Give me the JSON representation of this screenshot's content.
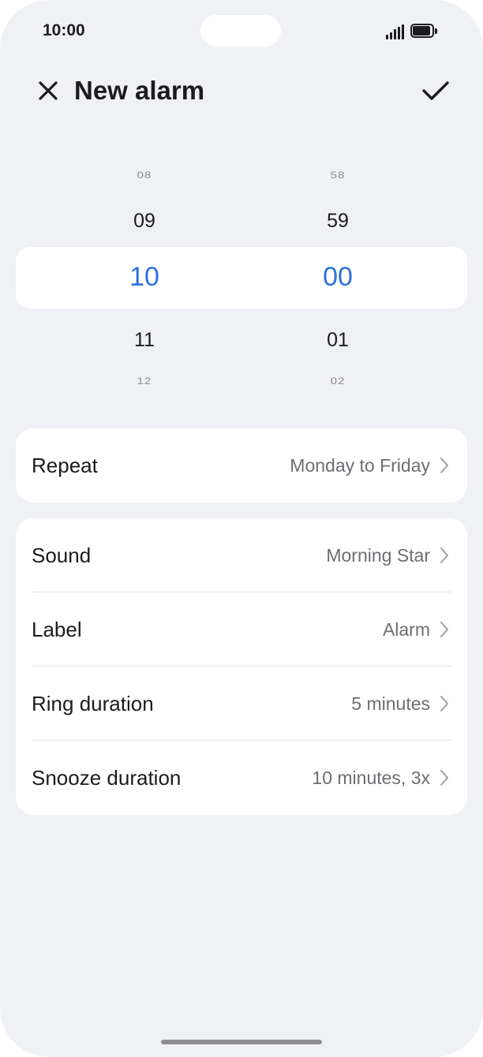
{
  "status_bar": {
    "time": "10:00",
    "icons": [
      "signal-icon",
      "battery-icon"
    ]
  },
  "header": {
    "title": "New alarm",
    "close_icon": "close-icon",
    "confirm_icon": "checkmark-icon"
  },
  "picker": {
    "hours": {
      "above2": "08",
      "above1": "09",
      "selected": "10",
      "below1": "11",
      "below2": "12"
    },
    "minutes": {
      "above2": "58",
      "above1": "59",
      "selected": "00",
      "below1": "01",
      "below2": "02"
    },
    "accent_color": "#2f6fe0"
  },
  "repeat": {
    "label": "Repeat",
    "value": "Monday to Friday"
  },
  "settings": [
    {
      "label": "Sound",
      "value": "Morning Star"
    },
    {
      "label": "Label",
      "value": "Alarm"
    },
    {
      "label": "Ring duration",
      "value": "5 minutes"
    },
    {
      "label": "Snooze duration",
      "value": "10 minutes, 3x"
    }
  ]
}
